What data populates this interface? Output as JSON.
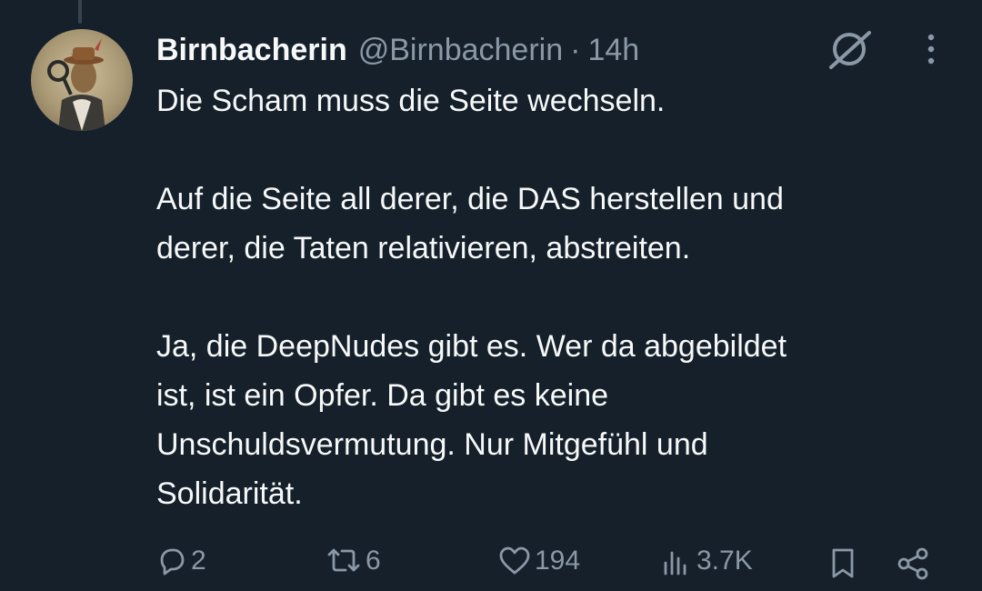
{
  "author": {
    "display_name": "Birnbacherin",
    "handle": "@Birnbacherin",
    "separator": "·",
    "time": "14h"
  },
  "tweet": {
    "paragraphs": [
      "Die Scham muss die Seite wechseln.",
      "Auf die Seite all derer, die DAS herstellen und\nderer,  die Taten relativieren, abstreiten.",
      "Ja, die DeepNudes gibt es. Wer da abgebildet\nist, ist ein Opfer. Da gibt es keine\nUnschuldsvermutung. Nur Mitgefühl und\nSolidarität."
    ]
  },
  "actions": {
    "replies": "2",
    "retweets": "6",
    "likes": "194",
    "views": "3.7K"
  },
  "icons": {
    "reply": "reply-icon",
    "retweet": "retweet-icon",
    "like": "heart-icon",
    "views": "views-icon",
    "bookmark": "bookmark-icon",
    "share": "share-icon",
    "grok": "grok-icon",
    "more": "more-icon"
  },
  "colors": {
    "background": "#15202b",
    "text_primary": "#f7f9f9",
    "text_secondary": "#8b98a5"
  }
}
